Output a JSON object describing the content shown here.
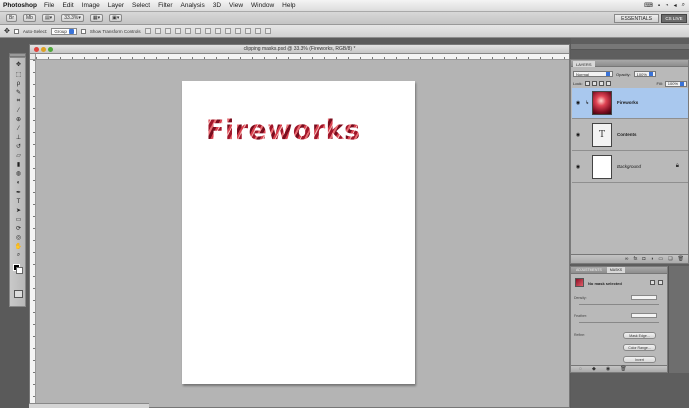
{
  "menubar": {
    "app_name": "Photoshop",
    "items": [
      "File",
      "Edit",
      "Image",
      "Layer",
      "Select",
      "Filter",
      "Analysis",
      "3D",
      "View",
      "Window",
      "Help"
    ]
  },
  "appbar": {
    "zoom": "33.3%",
    "workspace": "ESSENTIALS",
    "cs_live": "CS LIVE"
  },
  "options": {
    "auto_select_label": "Auto-Select:",
    "auto_select_value": "Group",
    "show_transform_label": "Show Transform Controls"
  },
  "document": {
    "title": "clipping masks.psd @ 33.3% (Fireworks, RGB/8) *",
    "canvas_text": "Fireworks"
  },
  "layers_panel": {
    "tab": "LAYERS",
    "blend_mode": "Normal",
    "opacity_label": "Opacity:",
    "opacity": "100%",
    "lock_label": "Lock:",
    "fill_label": "Fill:",
    "fill": "100%",
    "layers": [
      {
        "name": "Fireworks",
        "kind": "image",
        "selected": true
      },
      {
        "name": "Contents",
        "kind": "text",
        "selected": false
      },
      {
        "name": "Background",
        "kind": "fill",
        "selected": false
      }
    ]
  },
  "masks_panel": {
    "tabs": [
      "ADJUSTMENTS",
      "MASKS"
    ],
    "active_tab": "MASKS",
    "status": "No mask selected",
    "density_label": "Density:",
    "feather_label": "Feather:",
    "refine_label": "Refine:",
    "buttons": [
      "Mask Edge...",
      "Color Range...",
      "Invert"
    ]
  },
  "colors": {
    "selection": "#a9c8ee",
    "accent": "#3a73d8",
    "firework_red": "#a1162a"
  }
}
